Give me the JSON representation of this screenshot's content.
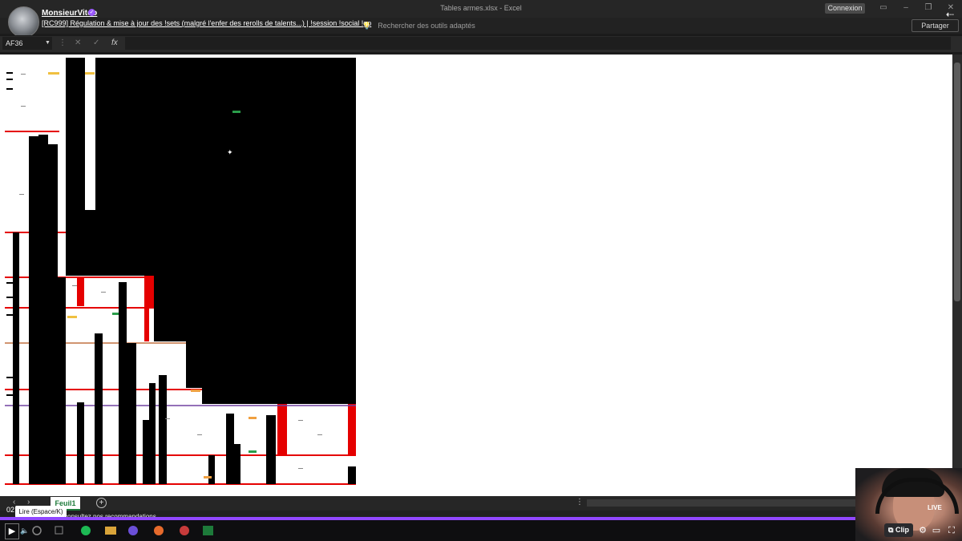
{
  "window": {
    "title": "Tables armes.xlsx  -  Excel",
    "sign_in": "Connexion",
    "minimize": "–",
    "restore": "❐",
    "close": "✕"
  },
  "ribbon": {
    "search_placeholder": "Rechercher des outils adaptés",
    "share": "Partager"
  },
  "stream": {
    "streamer": "MonsieurVitoo",
    "title": "[RC999] Régulation & mise à jour des !sets (malgré l'enfer des rerolls de talents...) | !session !social !gp",
    "collapse_icon": "⇠"
  },
  "formula_bar": {
    "name_box": "AF36",
    "more": "⋮",
    "cancel": "✕",
    "enter": "✓",
    "fx": "fx"
  },
  "sheet": {
    "tab": "Feuil1",
    "add": "+",
    "prev": "‹",
    "next": "›",
    "menu": "⋮"
  },
  "player": {
    "tooltip": "Lire (Espace/K)",
    "time": "02",
    "recommendation": "consultez nos recommandations",
    "live": "LIVE",
    "clip": "Clip",
    "play_icon": "▶",
    "volume_icon": "🔈",
    "settings_icon": "⚙",
    "theatre_icon": "▭",
    "fullscreen_icon": "⛶"
  },
  "colors": {
    "accent": "#9147ff",
    "excel_green": "#1d7a3a",
    "red_band": "#e50000"
  }
}
